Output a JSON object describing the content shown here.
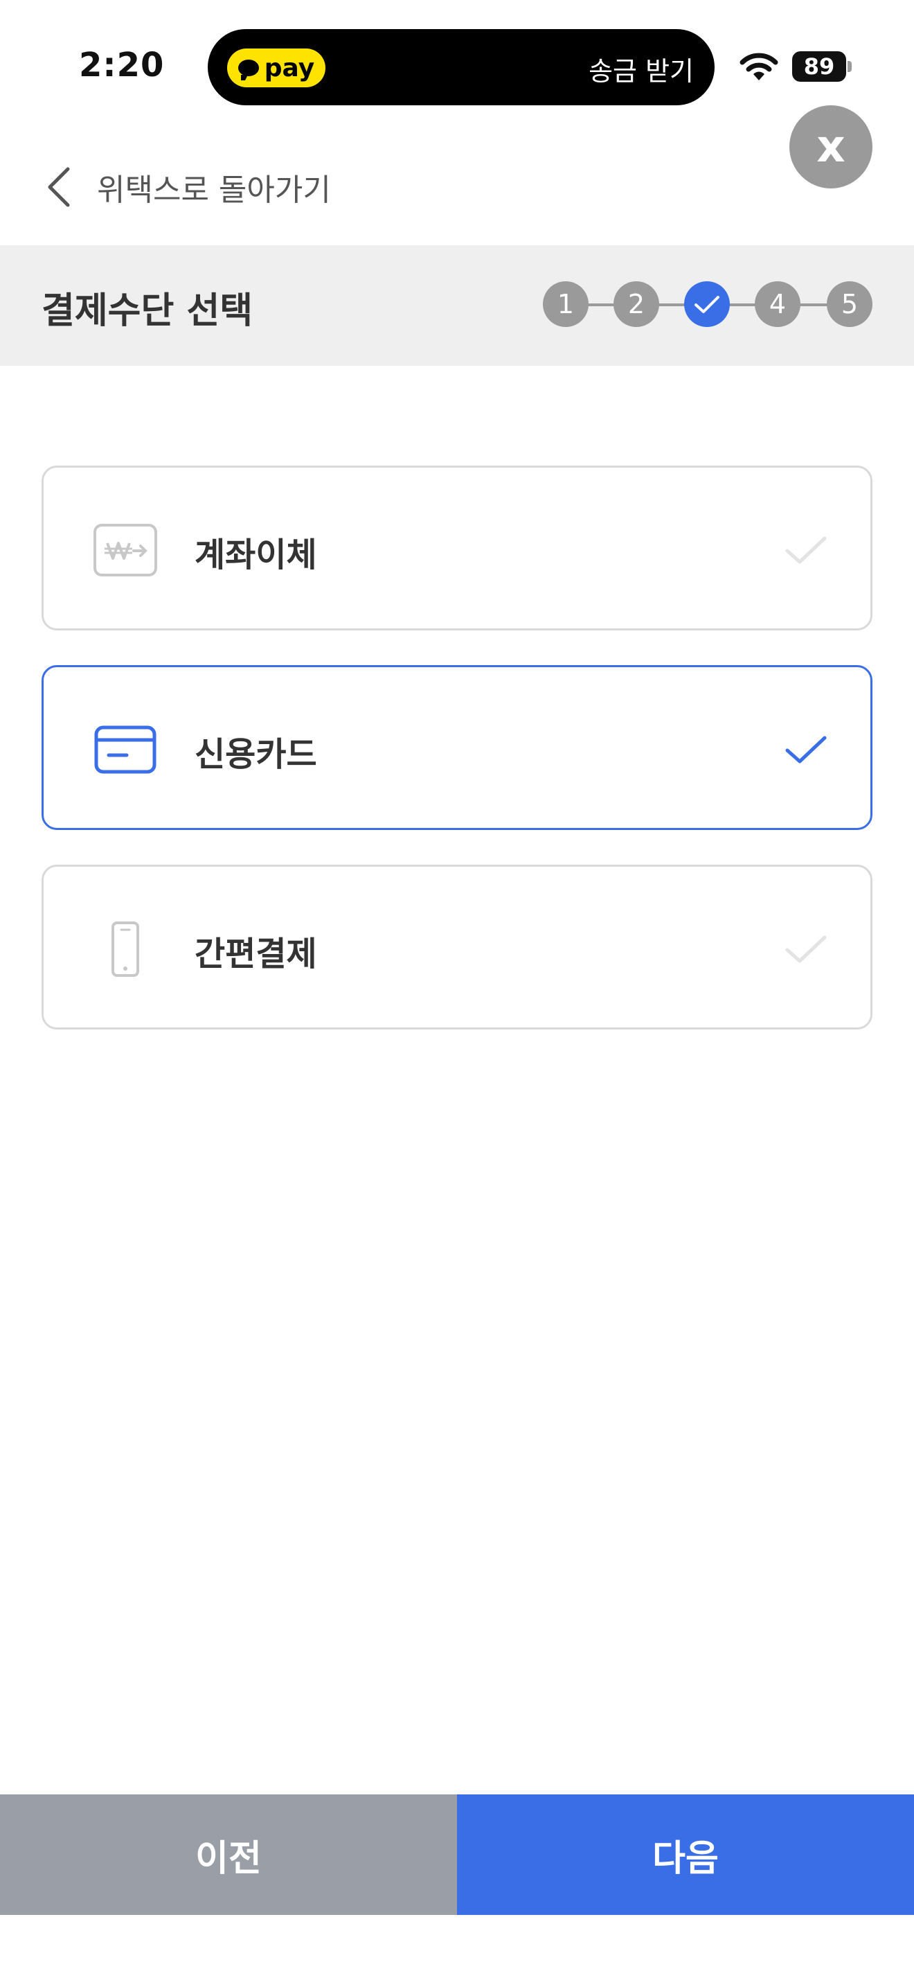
{
  "status_bar": {
    "time": "2:20",
    "pay_label": "pay",
    "island_text": "송금 받기",
    "battery": "89"
  },
  "close_label": "x",
  "back": {
    "label": "위택스로 돌아가기"
  },
  "header": {
    "title": "결제수단 선택",
    "steps": [
      "1",
      "2",
      "",
      "4",
      "5"
    ],
    "active_step": 3
  },
  "options": [
    {
      "label": "계좌이체",
      "icon": "bank-transfer-icon",
      "selected": false
    },
    {
      "label": "신용카드",
      "icon": "credit-card-icon",
      "selected": true
    },
    {
      "label": "간편결제",
      "icon": "phone-icon",
      "selected": false
    }
  ],
  "buttons": {
    "prev": "이전",
    "next": "다음"
  },
  "colors": {
    "accent": "#3a6ee6",
    "inactive": "#9a9a9a",
    "prev_button": "#9a9ea6",
    "pay_yellow": "#ffe300"
  }
}
